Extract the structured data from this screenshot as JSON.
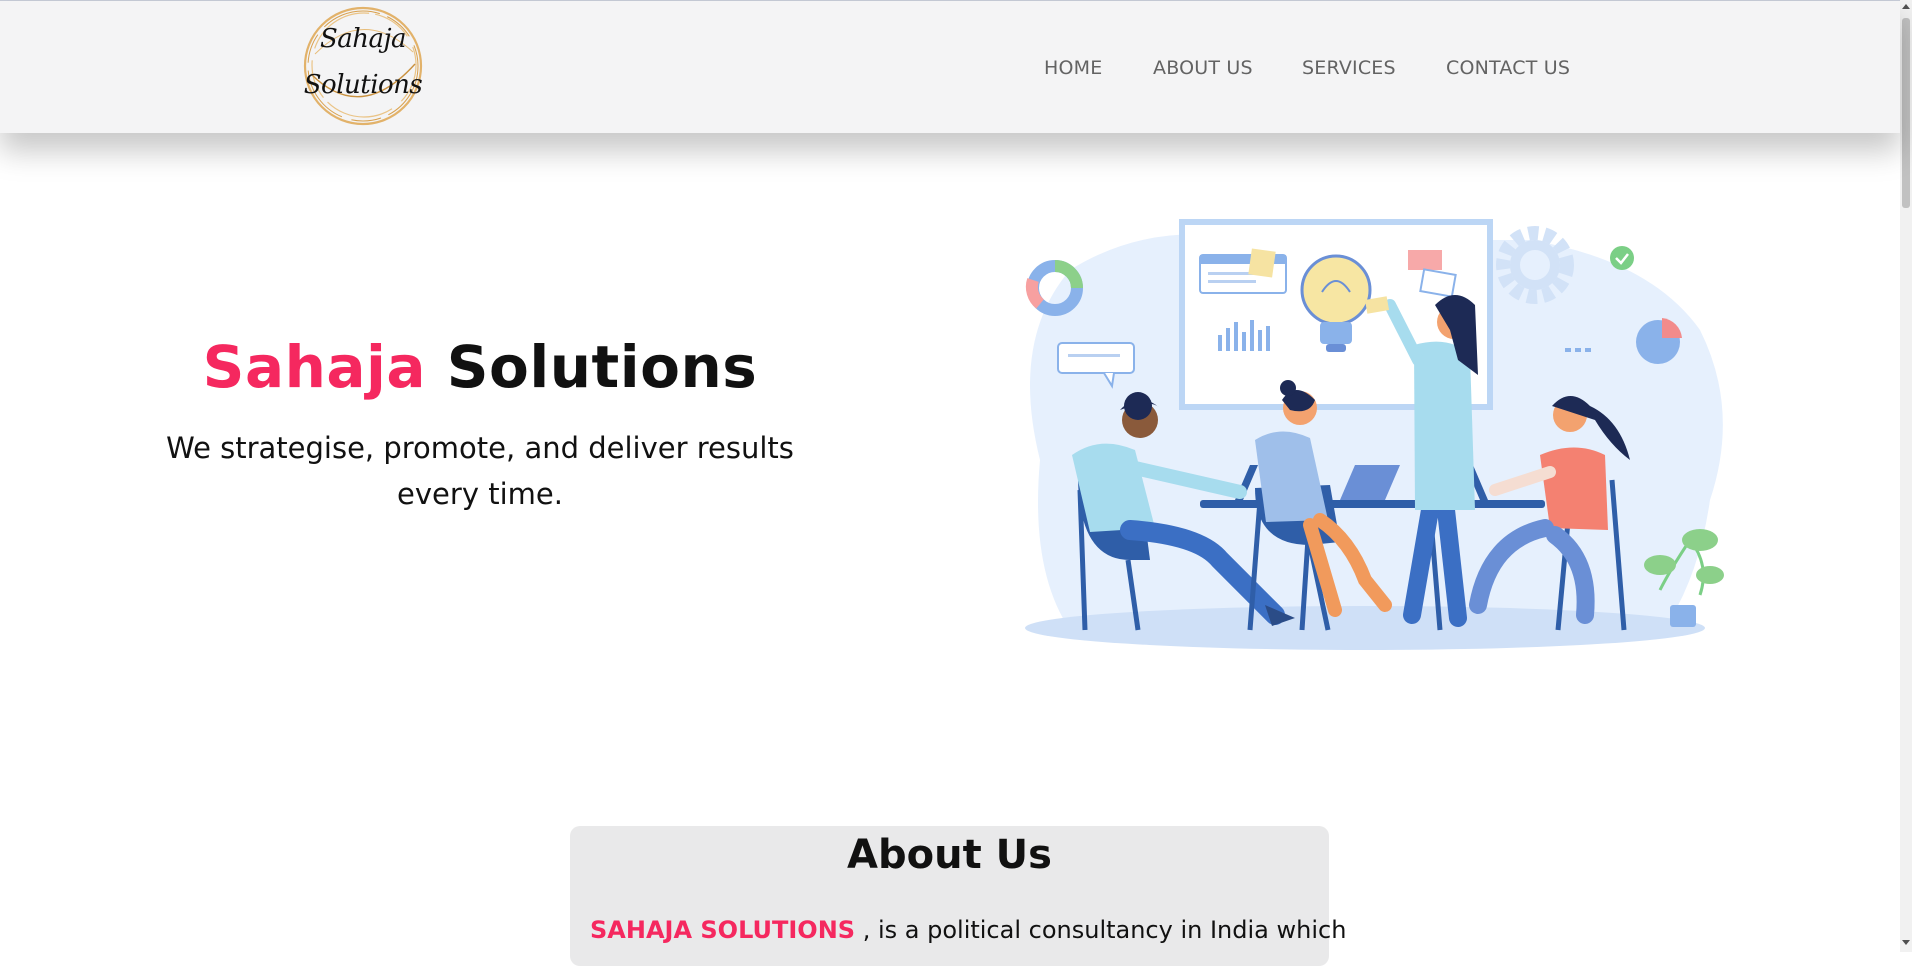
{
  "brand": {
    "logo_line1": "Sahaja",
    "logo_line2": "Solutions"
  },
  "nav": {
    "items": [
      {
        "label": "HOME"
      },
      {
        "label": "ABOUT US"
      },
      {
        "label": "SERVICES"
      },
      {
        "label": "CONTACT US"
      }
    ]
  },
  "hero": {
    "title_highlight": "Sahaja",
    "title_rest": "Solutions",
    "subtitle_line1": "We strategise, promote, and deliver results",
    "subtitle_line2": "every time."
  },
  "about": {
    "heading": "About Us",
    "company_name": "SAHAJA SOLUTIONS",
    "text": " , is a political consultancy in India which"
  },
  "colors": {
    "accent": "#f5285f",
    "navbar_bg": "#f4f4f5",
    "nav_text": "#636363",
    "card_bg": "#e9e9ea"
  },
  "icons": {
    "illustration": "team-meeting-illustration",
    "logo": "circular-gold-ring-logo"
  }
}
